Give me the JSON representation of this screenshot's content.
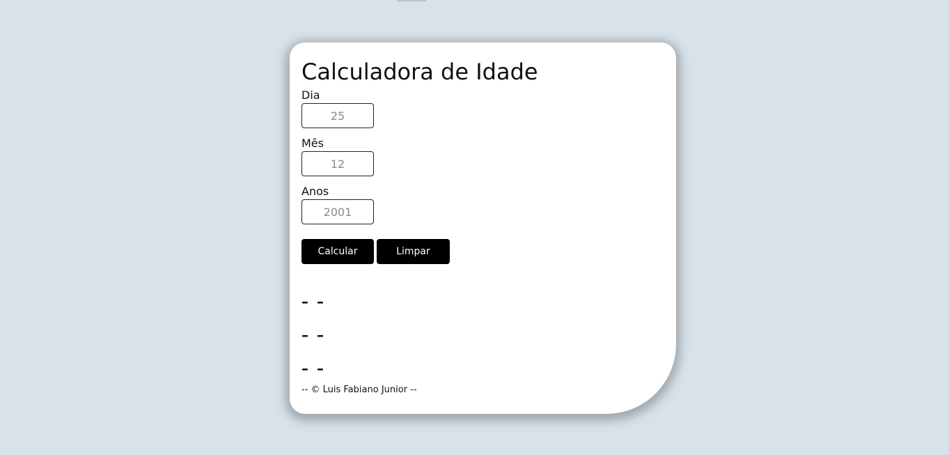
{
  "app": {
    "title": "Calculadora de Idade"
  },
  "form": {
    "dia": {
      "label": "Dia",
      "placeholder": "25"
    },
    "mes": {
      "label": "Mês",
      "placeholder": "12"
    },
    "anos": {
      "label": "Anos",
      "placeholder": "2001"
    }
  },
  "buttons": {
    "calcular": "Calcular",
    "limpar": "Limpar"
  },
  "results": [
    {
      "value": "–",
      "unit": "–"
    },
    {
      "value": "–",
      "unit": "–"
    },
    {
      "value": "–",
      "unit": "–"
    }
  ],
  "footer": {
    "text": "-- © Luis Fabiano Junior --"
  },
  "colors": {
    "background": "#dae2e9",
    "card": "#ffffff",
    "button": "#000000",
    "button_text": "#ffffff"
  }
}
